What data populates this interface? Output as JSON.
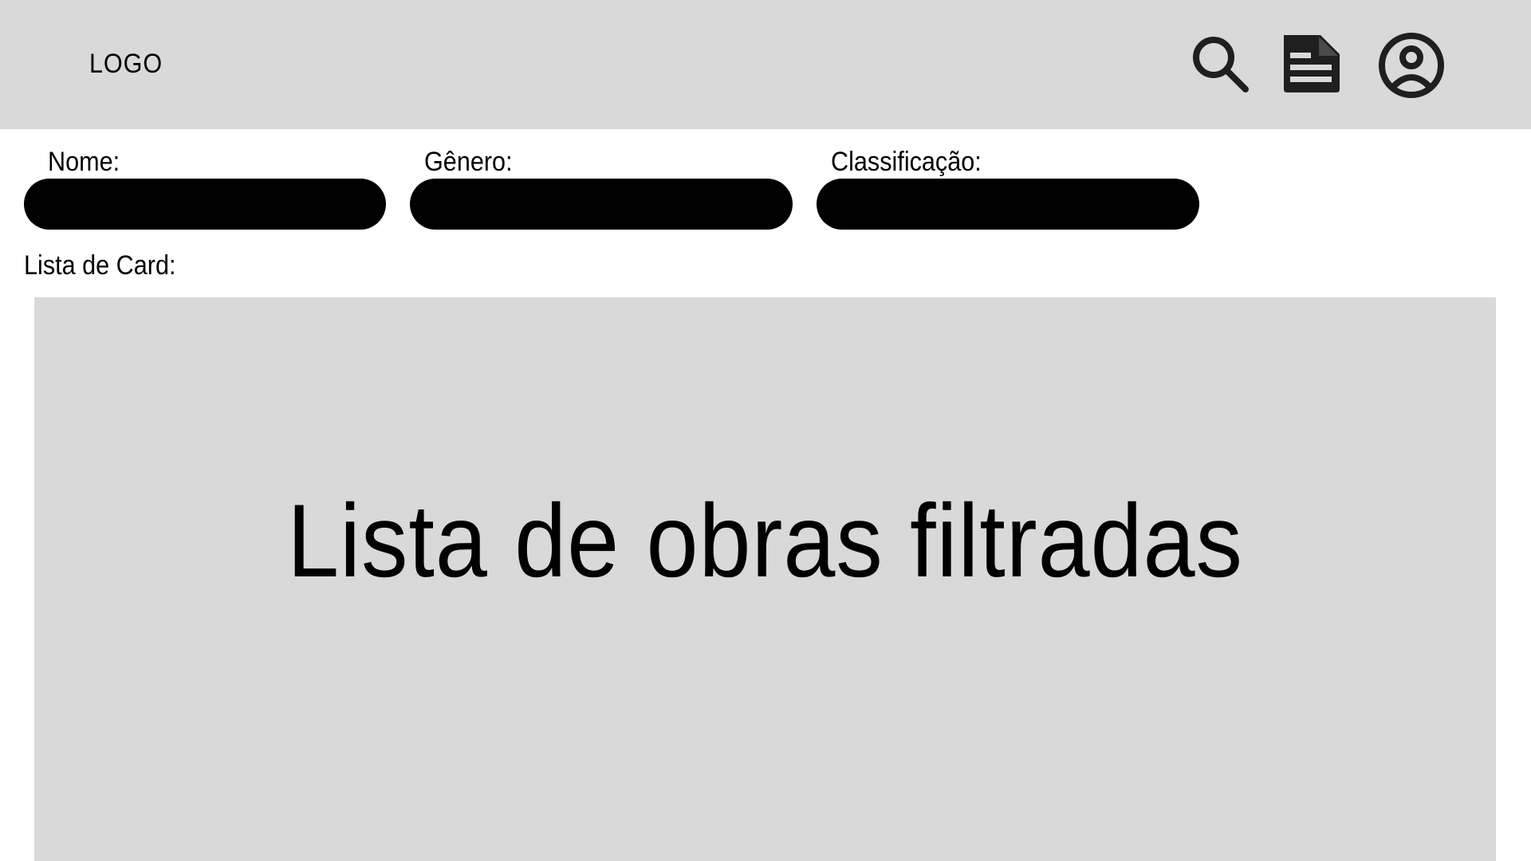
{
  "header": {
    "logo_text": "LOGO",
    "icons": [
      "search-icon",
      "document-icon",
      "user-account-icon"
    ]
  },
  "filters": {
    "name_label": "Nome:",
    "genre_label": "Gênero:",
    "rating_label": "Classificação:",
    "name_value": "",
    "genre_value": "",
    "rating_value": ""
  },
  "list": {
    "section_label": "Lista de Card:",
    "placeholder_text": "Lista de obras filtradas"
  },
  "colors": {
    "header_bg": "#d9d9d9",
    "panel_bg": "#d9d9d9",
    "input_bg": "#000000",
    "icon_color": "#1f1f1f",
    "page_bg": "#ffffff"
  }
}
